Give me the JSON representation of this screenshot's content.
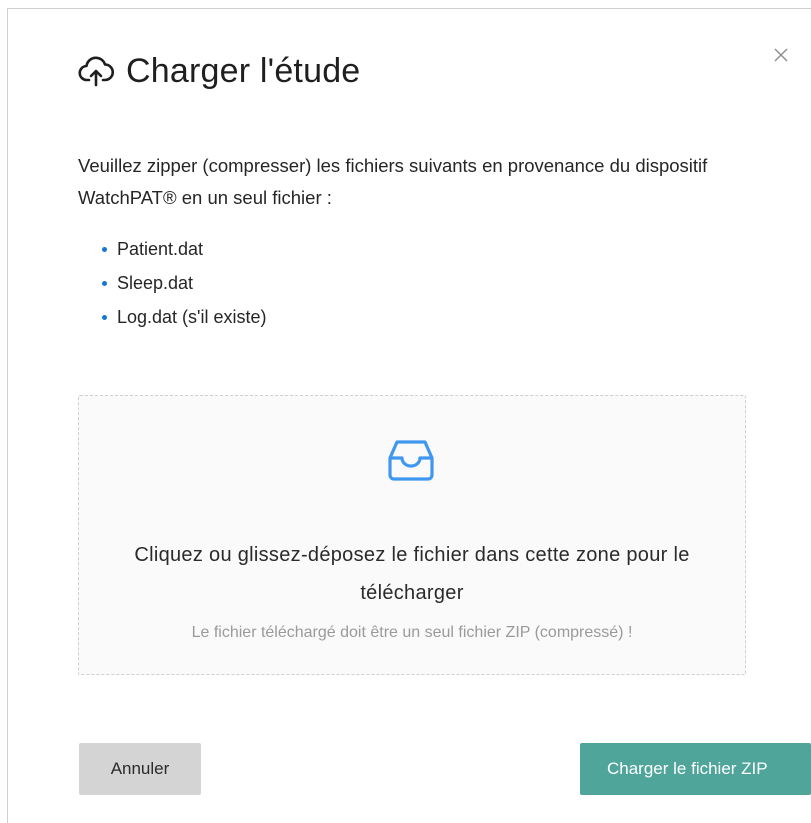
{
  "dialog": {
    "title": "Charger l'étude",
    "title_icon": "cloud-upload-icon",
    "close_icon": "close-icon",
    "description": "Veuillez zipper (compresser) les fichiers suivants en provenance du dispositif WatchPAT® en un seul fichier :",
    "files": [
      "Patient.dat",
      "Sleep.dat",
      "Log.dat (s'il existe)"
    ]
  },
  "dropzone": {
    "icon": "inbox-icon",
    "text": "Cliquez ou glissez-déposez le fichier dans cette zone pour le télécharger",
    "hint": "Le fichier téléchargé doit être un seul fichier ZIP (compressé) !"
  },
  "footer": {
    "cancel_label": "Annuler",
    "upload_label": "Charger le fichier ZIP"
  },
  "colors": {
    "accent": "#1677d2",
    "primary_button": "#4fa59a",
    "cancel_button": "#d4d4d4"
  }
}
